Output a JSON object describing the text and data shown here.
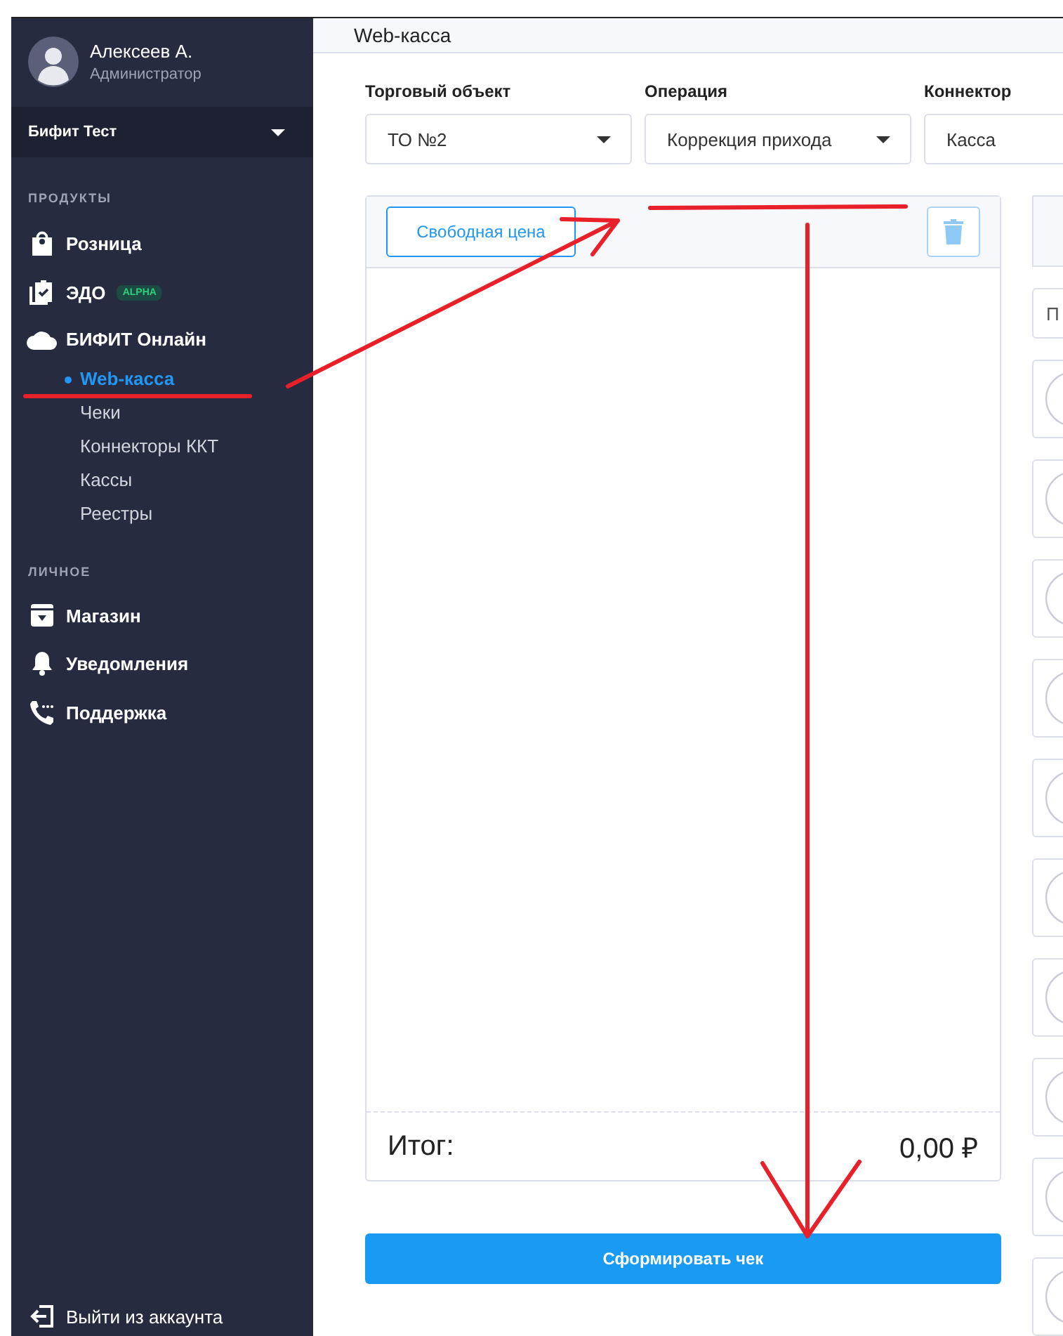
{
  "user": {
    "name": "Алексеев А.",
    "role": "Администратор"
  },
  "org": {
    "name": "Бифит Тест"
  },
  "sections": [
    {
      "heading": "ПРОДУКТЫ",
      "items": [
        {
          "label": "Розница"
        },
        {
          "label": "ЭДО",
          "badge": "ALPHA"
        },
        {
          "label": "БИФИТ Онлайн",
          "children": [
            {
              "label": "Web-касса",
              "selected": true
            },
            {
              "label": "Чеки",
              "selected": false
            },
            {
              "label": "Коннекторы ККТ",
              "selected": false
            },
            {
              "label": "Кассы",
              "selected": false
            },
            {
              "label": "Реестры",
              "selected": false
            }
          ]
        }
      ]
    },
    {
      "heading": "ЛИЧНОЕ",
      "items": [
        {
          "label": "Магазин"
        },
        {
          "label": "Уведомления"
        },
        {
          "label": "Поддержка"
        }
      ]
    }
  ],
  "logout": "Выйти из аккаунта",
  "page_title": "Web-касса",
  "selects": [
    {
      "label": "Торговый объект",
      "value": "ТО №2"
    },
    {
      "label": "Операция",
      "value": "Коррекция прихода"
    },
    {
      "label": "Коннектор",
      "value": "Касса"
    }
  ],
  "cart": {
    "free_price_button": "Свободная цена",
    "total_label": "Итог:",
    "total_value": "0,00 ₽"
  },
  "submit_button": "Сформировать чек",
  "catalog": {
    "search_placeholder": "П"
  }
}
